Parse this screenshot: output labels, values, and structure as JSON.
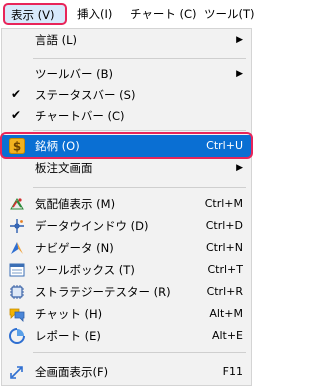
{
  "menubar": {
    "items": [
      {
        "label": "表示 (V)"
      },
      {
        "label": "挿入(I)"
      },
      {
        "label": "チャート (C)"
      },
      {
        "label": "ツール(T)"
      }
    ]
  },
  "menu": {
    "language": {
      "label": "言語 (L)"
    },
    "toolbar": {
      "label": "ツールバー (B)"
    },
    "statusbar": {
      "label": "ステータスバー (S)"
    },
    "chartbar": {
      "label": "チャートバー (C)"
    },
    "symbols": {
      "label": "銘柄 (O)",
      "shortcut": "Ctrl+U"
    },
    "order_screen": {
      "label": "板注文画面"
    },
    "market_watch": {
      "label": "気配値表示 (M)",
      "shortcut": "Ctrl+M"
    },
    "data_window": {
      "label": "データウインドウ (D)",
      "shortcut": "Ctrl+D"
    },
    "navigator": {
      "label": "ナビゲータ (N)",
      "shortcut": "Ctrl+N"
    },
    "toolbox": {
      "label": "ツールボックス (T)",
      "shortcut": "Ctrl+T"
    },
    "strategy_tester": {
      "label": "ストラテジーテスター (R)",
      "shortcut": "Ctrl+R"
    },
    "chat": {
      "label": "チャット (H)",
      "shortcut": "Alt+M"
    },
    "report": {
      "label": "レポート (E)",
      "shortcut": "Alt+E"
    },
    "fullscreen": {
      "label": "全画面表示(F)",
      "shortcut": "F11"
    }
  }
}
